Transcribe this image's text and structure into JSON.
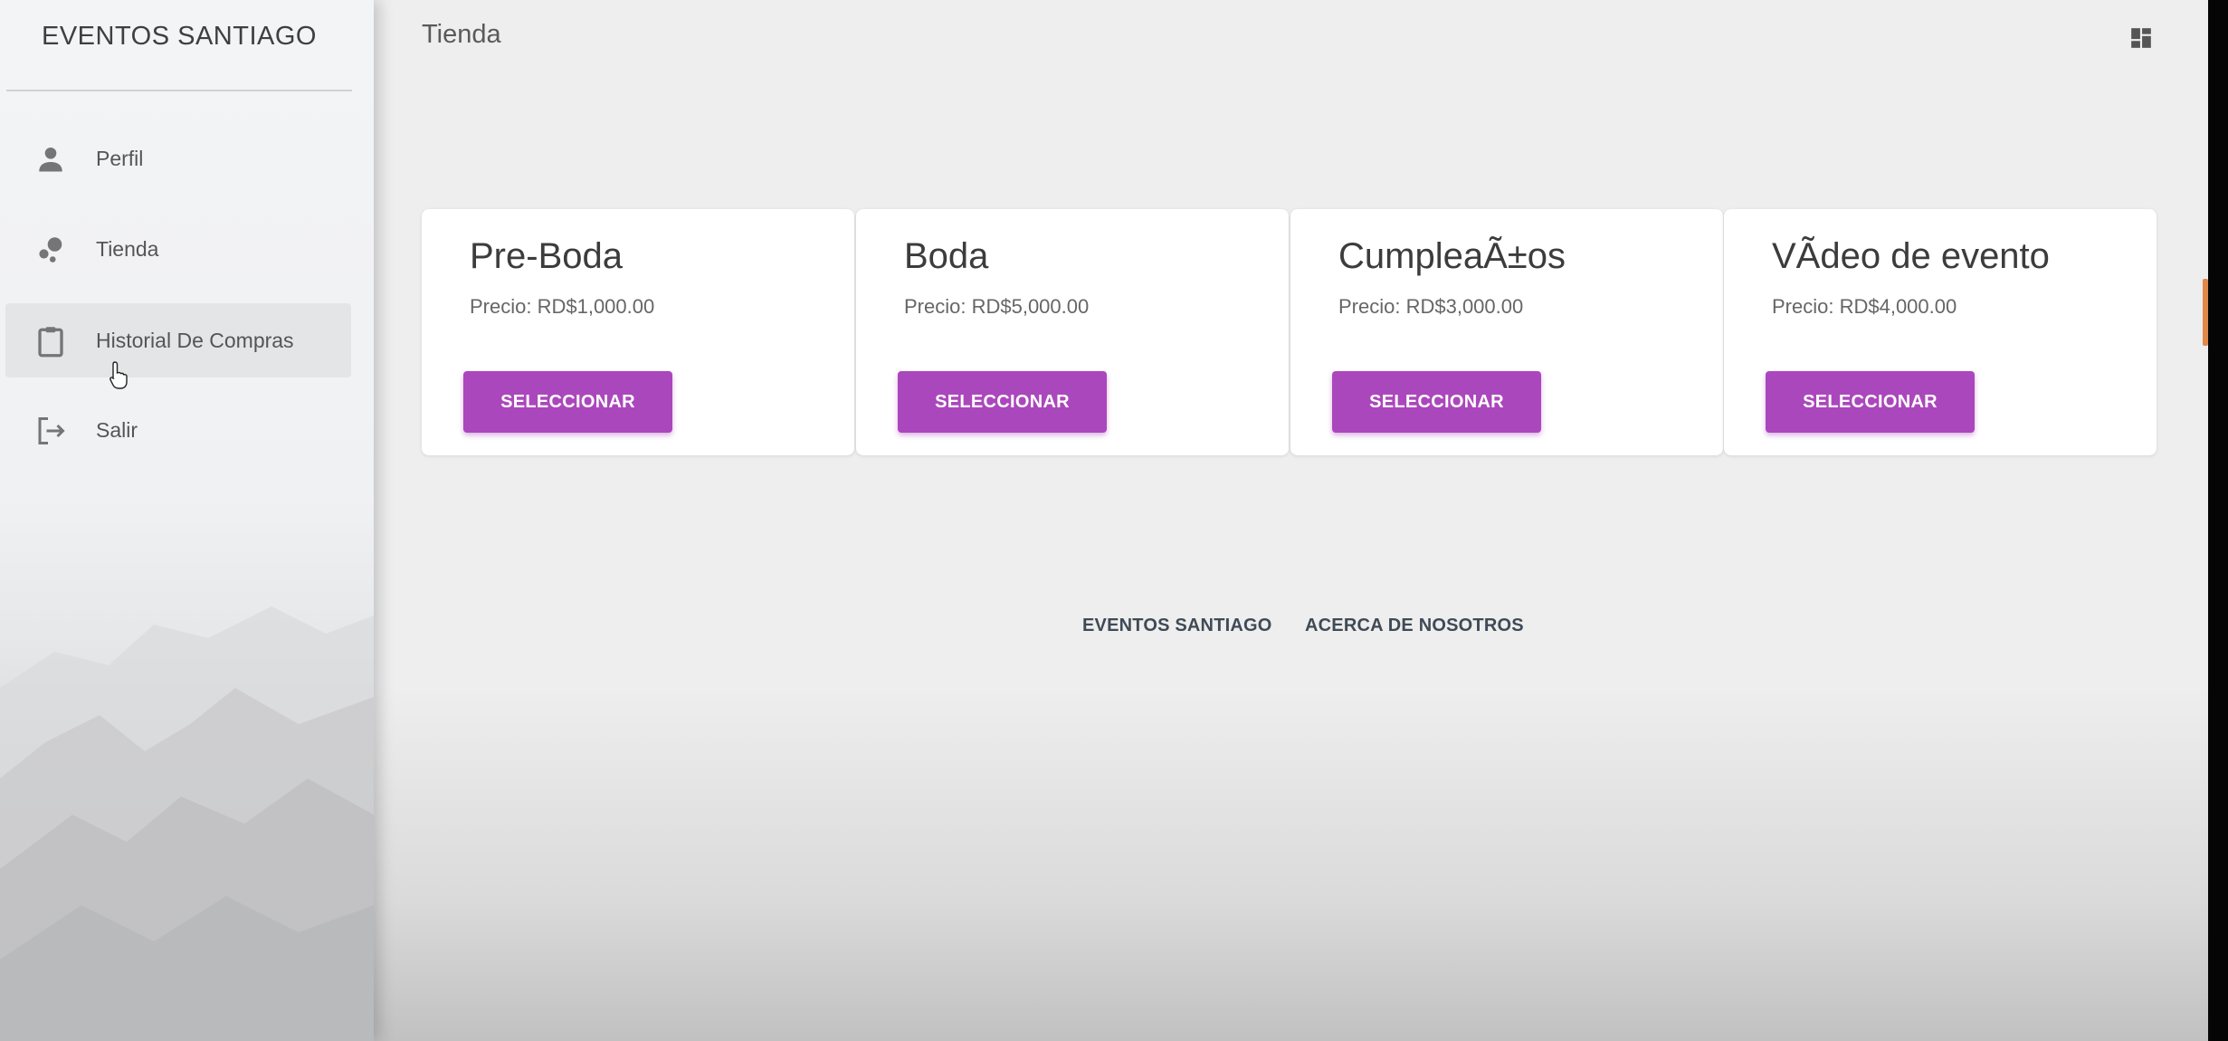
{
  "sidebar": {
    "brand": "EVENTOS SANTIAGO",
    "items": [
      {
        "label": "Perfil",
        "icon": "person-icon"
      },
      {
        "label": "Tienda",
        "icon": "bubbles-icon"
      },
      {
        "label": "Historial De Compras",
        "icon": "clipboard-icon",
        "active": true
      },
      {
        "label": "Salir",
        "icon": "logout-icon"
      }
    ]
  },
  "header": {
    "title": "Tienda",
    "right_icon": "dashboard-icon"
  },
  "products": [
    {
      "title": "Pre-Boda",
      "price": "Precio: RD$1,000.00",
      "button": "SELECCIONAR"
    },
    {
      "title": "Boda",
      "price": "Precio: RD$5,000.00",
      "button": "SELECCIONAR"
    },
    {
      "title": "CumpleaÃ±os",
      "price": "Precio: RD$3,000.00",
      "button": "SELECCIONAR"
    },
    {
      "title": "VÃdeo de evento",
      "price": "Precio: RD$4,000.00",
      "button": "SELECCIONAR"
    }
  ],
  "footer": {
    "links": [
      "EVENTOS SANTIAGO",
      "ACERCA DE NOSOTROS"
    ]
  },
  "colors": {
    "accent": "#ab47bc",
    "background": "#eeeeee",
    "card": "#ffffff"
  }
}
